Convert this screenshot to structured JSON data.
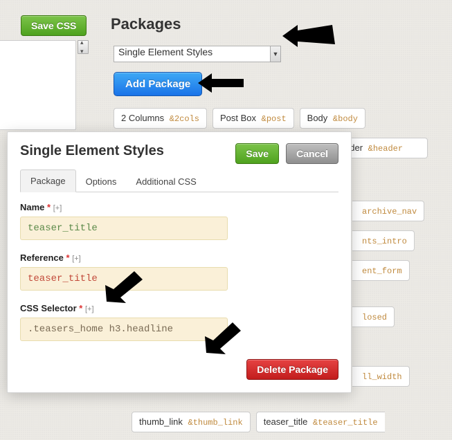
{
  "toolbar": {
    "save_css": "Save CSS"
  },
  "page_title": "Packages",
  "select": {
    "selected": "Single Element Styles"
  },
  "add_package": "Add Package",
  "pills_row1": [
    {
      "label": "2 Columns",
      "ref": "&2cols"
    },
    {
      "label": "Post Box",
      "ref": "&post"
    },
    {
      "label": "Body",
      "ref": "&body"
    }
  ],
  "pills_row2": {
    "label_suffix": "ader",
    "ref": "&header"
  },
  "right_frags": [
    {
      "label_suffix": "archive_nav"
    },
    {
      "label_suffix": "nts_intro"
    },
    {
      "label_suffix": "ent_form"
    },
    {
      "label_suffix": "losed"
    },
    {
      "label_suffix": "ll_width"
    }
  ],
  "bottom_pills": [
    {
      "label": "thumb_link",
      "ref": "&thumb_link"
    },
    {
      "label": "teaser_title",
      "ref": "&teaser_title"
    }
  ],
  "modal": {
    "title": "Single Element Styles",
    "save": "Save",
    "cancel": "Cancel",
    "tabs": {
      "package": "Package",
      "options": "Options",
      "css": "Additional CSS"
    },
    "fields": {
      "name": {
        "label": "Name",
        "plus": "[+]",
        "value": "teaser_title"
      },
      "reference": {
        "label": "Reference",
        "plus": "[+]",
        "value": "teaser_title"
      },
      "selector": {
        "label": "CSS Selector",
        "plus": "[+]",
        "value": ".teasers_home h3.headline"
      }
    },
    "delete": "Delete Package"
  }
}
